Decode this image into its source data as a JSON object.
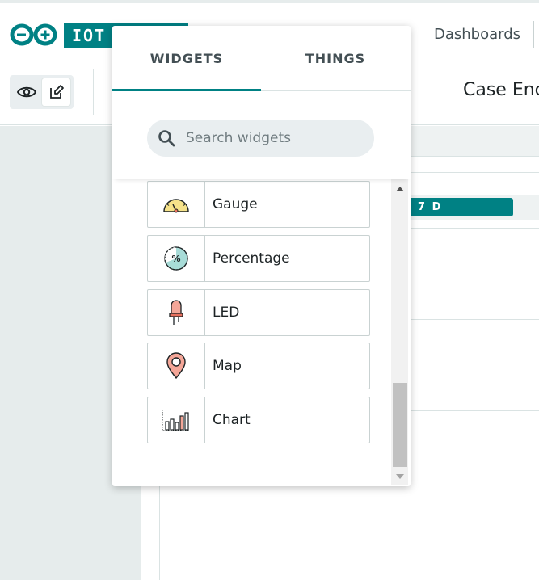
{
  "header": {
    "brand": "IOT",
    "nav_dashboards": "Dashboards"
  },
  "toolbar": {
    "dashboard_title": "Case Enc"
  },
  "timeline": {
    "range_label": "7 D"
  },
  "popup": {
    "tabs": [
      {
        "label": "WIDGETS",
        "active": true
      },
      {
        "label": "THINGS",
        "active": false
      }
    ],
    "search_placeholder": "Search widgets",
    "widgets": [
      {
        "label": "Gauge",
        "icon": "gauge-icon"
      },
      {
        "label": "Percentage",
        "icon": "percentage-icon"
      },
      {
        "label": "LED",
        "icon": "led-icon"
      },
      {
        "label": "Map",
        "icon": "map-icon"
      },
      {
        "label": "Chart",
        "icon": "chart-icon"
      }
    ]
  },
  "colors": {
    "brand_teal": "#008184",
    "panel_grey": "#e6ecec",
    "border": "#dae3e3"
  }
}
